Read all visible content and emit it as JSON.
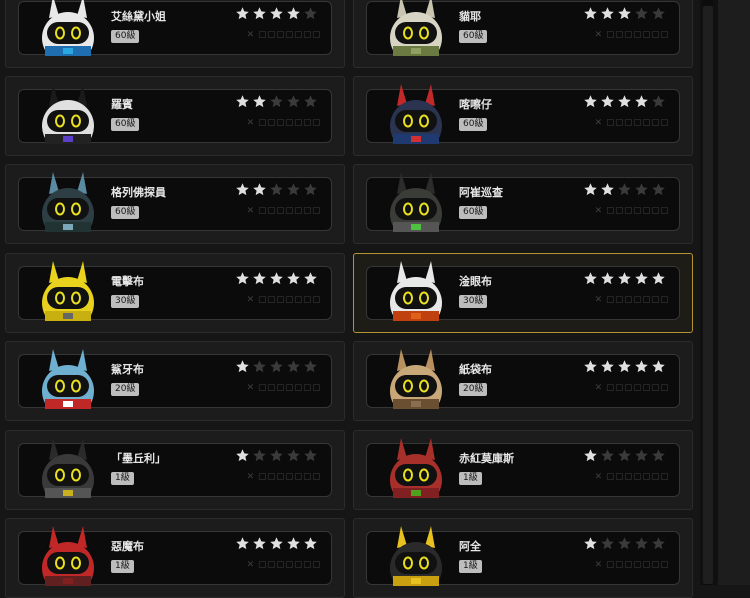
{
  "characters": [
    {
      "name": "艾絲黛小姐",
      "level": "60級",
      "stars": 4,
      "id": "✕ ▢▢▢▢▢▢▢",
      "selected": false
    },
    {
      "name": "貓耶",
      "level": "60級",
      "stars": 3,
      "id": "✕ ▢▢▢▢▢▢▢",
      "selected": false
    },
    {
      "name": "羅賓",
      "level": "60級",
      "stars": 2,
      "id": "✕ ▢▢▢▢▢▢▢",
      "selected": false
    },
    {
      "name": "喀嚓仔",
      "level": "60級",
      "stars": 4,
      "id": "✕ ▢▢▢▢▢▢▢",
      "selected": false
    },
    {
      "name": "格列佛探員",
      "level": "60級",
      "stars": 2,
      "id": "✕ ▢▢▢▢▢▢▢",
      "selected": false
    },
    {
      "name": "阿崔巡查",
      "level": "60級",
      "stars": 2,
      "id": "✕ ▢▢▢▢▢▢▢",
      "selected": false
    },
    {
      "name": "電擊布",
      "level": "30級",
      "stars": 5,
      "id": "✕ ▢▢▢▢▢▢▢",
      "selected": false
    },
    {
      "name": "淦眼布",
      "level": "30級",
      "stars": 5,
      "id": "✕ ▢▢▢▢▢▢▢",
      "selected": true
    },
    {
      "name": "鯊牙布",
      "level": "20級",
      "stars": 1,
      "id": "✕ ▢▢▢▢▢▢▢",
      "selected": false
    },
    {
      "name": "紙袋布",
      "level": "20級",
      "stars": 5,
      "id": "✕ ▢▢▢▢▢▢▢",
      "selected": false
    },
    {
      "name": "「墨丘利」",
      "level": "1級",
      "stars": 1,
      "id": "✕ ▢▢▢▢▢▢▢",
      "selected": false
    },
    {
      "name": "赤紅莫庫斯",
      "level": "1級",
      "stars": 1,
      "id": "✕ ▢▢▢▢▢▢▢",
      "selected": false
    },
    {
      "name": "惡魔布",
      "level": "1級",
      "stars": 5,
      "id": "✕ ▢▢▢▢▢▢▢",
      "selected": false
    },
    {
      "name": "阿全",
      "level": "1級",
      "stars": 1,
      "id": "✕ ▢▢▢▢▢▢▢",
      "selected": false
    }
  ],
  "avatar_icons": [
    "mask-bangboo-icon",
    "lamb-bangboo-icon",
    "biker-bangboo-icon",
    "firefighter-bangboo-icon",
    "diver-bangboo-icon",
    "soldier-bangboo-icon",
    "electro-bangboo-icon",
    "goggles-bangboo-icon",
    "shark-bangboo-icon",
    "paperbag-bangboo-icon",
    "horned-bangboo-icon",
    "boar-bangboo-icon",
    "devil-bangboo-icon",
    "hardhat-bangboo-icon"
  ],
  "colors": {
    "star_on": "#e0e0e0",
    "star_off": "#3a3a3a",
    "selected_border": "#b39333"
  }
}
